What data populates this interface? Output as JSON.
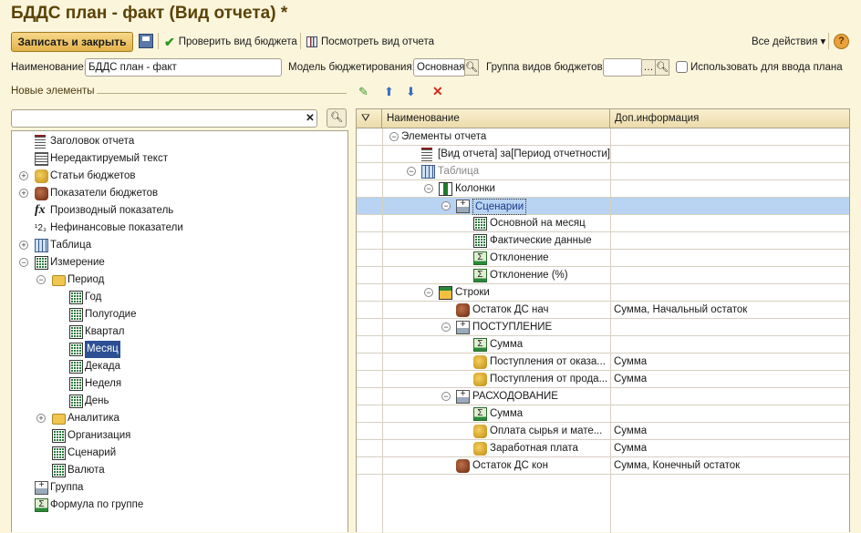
{
  "window": {
    "title": "БДДС план - факт (Вид отчета) *"
  },
  "toolbar": {
    "save_close": "Записать и закрыть",
    "check": "Проверить вид бюджета",
    "view": "Посмотреть вид отчета",
    "all_actions": "Все действия ▾",
    "help": "?"
  },
  "form": {
    "name_label": "Наименование:",
    "name_value": "БДДС план - факт",
    "model_label": "Модель бюджетирования:",
    "model_value": "Основная",
    "group_label": "Группа видов бюджетов:",
    "group_value": "",
    "use_plan_label": "Использовать для ввода плана",
    "use_plan_checked": false
  },
  "left": {
    "section_title": "Новые элементы",
    "search_value": "",
    "items": [
      {
        "label": "Заголовок отчета",
        "level": 0,
        "icon": "title"
      },
      {
        "label": "Нередактируемый текст",
        "level": 0,
        "icon": "text"
      },
      {
        "label": "Статьи бюджетов",
        "level": 0,
        "icon": "coins",
        "exp": "+"
      },
      {
        "label": "Показатели бюджетов",
        "level": 0,
        "icon": "coins-red",
        "exp": "+"
      },
      {
        "label": "Производный показатель",
        "level": 0,
        "icon": "fx"
      },
      {
        "label": "Нефинансовые показатели",
        "level": 0,
        "icon": "numbers"
      },
      {
        "label": "Таблица",
        "level": 0,
        "icon": "table",
        "exp": "+"
      },
      {
        "label": "Измерение",
        "level": 0,
        "icon": "grid",
        "exp": "-"
      },
      {
        "label": "Период",
        "level": 1,
        "icon": "folder",
        "exp": "-"
      },
      {
        "label": "Год",
        "level": 2,
        "icon": "grid"
      },
      {
        "label": "Полугодие",
        "level": 2,
        "icon": "grid"
      },
      {
        "label": "Квартал",
        "level": 2,
        "icon": "grid"
      },
      {
        "label": "Месяц",
        "level": 2,
        "icon": "grid",
        "selected": true
      },
      {
        "label": "Декада",
        "level": 2,
        "icon": "grid"
      },
      {
        "label": "Неделя",
        "level": 2,
        "icon": "grid"
      },
      {
        "label": "День",
        "level": 2,
        "icon": "grid"
      },
      {
        "label": "Аналитика",
        "level": 1,
        "icon": "folder",
        "exp": "+"
      },
      {
        "label": "Организация",
        "level": 1,
        "icon": "grid"
      },
      {
        "label": "Сценарий",
        "level": 1,
        "icon": "grid"
      },
      {
        "label": "Валюта",
        "level": 1,
        "icon": "grid"
      },
      {
        "label": "Группа",
        "level": 0,
        "icon": "group"
      },
      {
        "label": "Формула по группе",
        "level": 0,
        "icon": "sigma"
      }
    ]
  },
  "right": {
    "col_name": "Наименование",
    "col_info": "Доп.информация",
    "rows": [
      {
        "label": "Элементы отчета",
        "level": 1,
        "exp": "-",
        "info": ""
      },
      {
        "label": "[Вид отчета] за[Период отчетности]",
        "level": 2,
        "icon": "title",
        "info": ""
      },
      {
        "label": "Таблица",
        "level": 2,
        "icon": "table",
        "exp": "-",
        "info": "",
        "muted": true
      },
      {
        "label": "Колонки",
        "level": 3,
        "icon": "columns",
        "exp": "-",
        "info": ""
      },
      {
        "label": "Сценарии",
        "level": 4,
        "icon": "group",
        "exp": "-",
        "info": "",
        "selected": true
      },
      {
        "label": "Основной на месяц",
        "level": 5,
        "icon": "grid",
        "info": ""
      },
      {
        "label": "Фактические данные",
        "level": 5,
        "icon": "grid",
        "info": ""
      },
      {
        "label": "Отклонение",
        "level": 5,
        "icon": "sigma",
        "info": ""
      },
      {
        "label": "Отклонение (%)",
        "level": 5,
        "icon": "sigma",
        "info": ""
      },
      {
        "label": "Строки",
        "level": 3,
        "icon": "rows",
        "exp": "-",
        "info": ""
      },
      {
        "label": "Остаток ДС нач",
        "level": 4,
        "icon": "coins-red",
        "info": "Сумма, Начальный остаток"
      },
      {
        "label": "ПОСТУПЛЕНИЕ",
        "level": 4,
        "icon": "group",
        "exp": "-",
        "info": ""
      },
      {
        "label": "Сумма",
        "level": 5,
        "icon": "sigma",
        "info": ""
      },
      {
        "label": "Поступления от оказа...",
        "level": 5,
        "icon": "coins",
        "info": "Сумма"
      },
      {
        "label": "Поступления от прода...",
        "level": 5,
        "icon": "coins",
        "info": "Сумма"
      },
      {
        "label": "РАСХОДОВАНИЕ",
        "level": 4,
        "icon": "group",
        "exp": "-",
        "info": ""
      },
      {
        "label": "Сумма",
        "level": 5,
        "icon": "sigma",
        "info": ""
      },
      {
        "label": "Оплата сырья и мате...",
        "level": 5,
        "icon": "coins",
        "info": "Сумма"
      },
      {
        "label": "Заработная плата",
        "level": 5,
        "icon": "coins",
        "info": "Сумма"
      },
      {
        "label": "Остаток ДС кон",
        "level": 4,
        "icon": "coins-red",
        "info": "Сумма, Конечный остаток"
      }
    ]
  }
}
